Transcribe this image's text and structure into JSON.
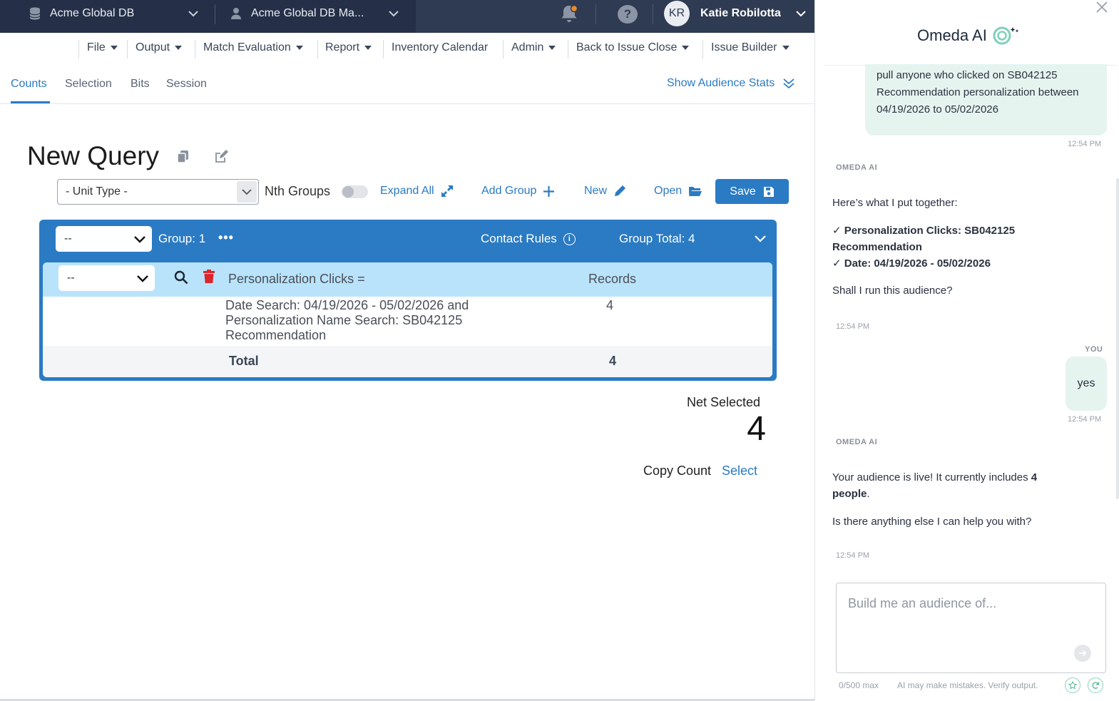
{
  "topbar": {
    "db_selector": "Acme Global DB",
    "db_manager": "Acme Global DB Ma...",
    "user_initials": "KR",
    "user_name": "Katie Robilotta",
    "help_label": "?"
  },
  "menu": {
    "items": [
      {
        "label": "File"
      },
      {
        "label": "Output"
      },
      {
        "label": "Match Evaluation"
      },
      {
        "label": "Report"
      },
      {
        "label": "Inventory Calendar"
      },
      {
        "label": "Admin"
      },
      {
        "label": "Back to Issue Close"
      },
      {
        "label": "Issue Builder"
      }
    ]
  },
  "tabs": {
    "items": [
      {
        "label": "Counts",
        "active": true
      },
      {
        "label": "Selection"
      },
      {
        "label": "Bits"
      },
      {
        "label": "Session"
      }
    ],
    "stats_link": "Show Audience Stats"
  },
  "query": {
    "title": "New Query",
    "unit_type_placeholder": "- Unit Type -",
    "nth_groups_label": "Nth Groups",
    "nth_groups_on": false,
    "expand_all": "Expand All",
    "add_group": "Add Group",
    "new": "New",
    "open": "Open",
    "save": "Save"
  },
  "group": {
    "operator": "--",
    "label": "Group: 1",
    "dots": "•••",
    "contact_rules": "Contact Rules",
    "info": "i",
    "total": "Group Total: 4",
    "rule": {
      "operator": "--",
      "name": "Personalization Clicks =",
      "records_header": "Records",
      "description": "Date Search: 04/19/2026 - 05/02/2026 and Personalization Name Search: SB042125 Recommendation",
      "count": "4",
      "total_label": "Total",
      "total_value": "4"
    }
  },
  "summary": {
    "net_selected_label": "Net Selected",
    "net_selected_value": "4",
    "copy_count_label": "Copy Count",
    "copy_count_action": "Select"
  },
  "ai": {
    "title": "Omeda AI",
    "messages": {
      "user1_text": "pull anyone who clicked on SB042125 Recommendation personalization between 04/19/2026 to 05/02/2026",
      "user1_time": "12:54 PM",
      "ai1_sender": "OMEDA AI",
      "ai1_intro": "Here’s what I put together:",
      "ai1_item1_key": "Personalization Clicks",
      "ai1_item1_val": ": SB042125 Recommendation",
      "ai1_item2_key": "Date",
      "ai1_item2_val": ": 04/19/2026 - 05/02/2026",
      "ai1_question": "Shall I run this audience?",
      "ai1_time": "12:54 PM",
      "user2_sender": "YOU",
      "user2_text": "yes",
      "user2_time": "12:54 PM",
      "ai2_sender": "OMEDA AI",
      "ai2_text_a": "Your audience is live! It currently includes ",
      "ai2_text_b": "4 people",
      "ai2_text_c": ".",
      "ai2_followup": "Is there anything else I can help you with?",
      "ai2_time": "12:54 PM"
    },
    "input_placeholder": "Build me an audience of...",
    "char_count": "0/500 max",
    "disclaimer": "AI may make mistakes. Verify output."
  },
  "colors": {
    "accent": "#2a7bc4",
    "topbar": "#2f3b52",
    "rule_header": "#b9e3fa",
    "danger": "#d9262c",
    "ai_bubble": "#e6f4ef"
  }
}
